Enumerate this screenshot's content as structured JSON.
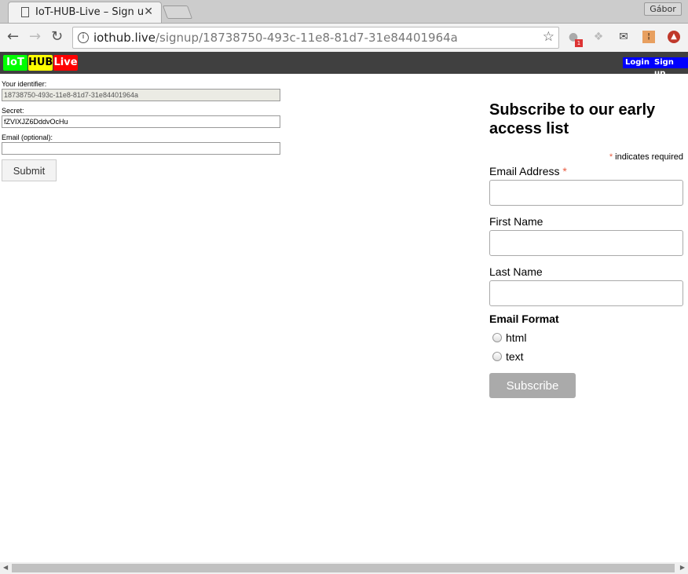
{
  "browser": {
    "tab_title": "IoT-HUB-Live – Sign u",
    "close": "✕",
    "user": "Gábor",
    "url_host": "iothub.live",
    "url_path": "/signup/18738750-493c-11e8-81d7-31e84401964a",
    "ext_badge": "1"
  },
  "site": {
    "logo": [
      "IoT",
      "HUB",
      "Live"
    ],
    "logo_colors": [
      "#00ff00",
      "#ffff00",
      "#ff0000"
    ],
    "login": "Login",
    "signup": "Sign up"
  },
  "signup": {
    "identifier_label": "Your identifier:",
    "identifier_value": "18738750-493c-11e8-81d7-31e84401964a",
    "secret_label": "Secret:",
    "secret_value": "fZVIXJZ6DddvOcHu",
    "email_label": "Email (optional):",
    "email_value": "",
    "submit": "Submit"
  },
  "subscribe": {
    "title": "Subscribe to our early access list",
    "required_mark": "*",
    "required_note": "indicates required",
    "email_label": "Email Address",
    "first_label": "First Name",
    "last_label": "Last Name",
    "format_label": "Email Format",
    "formats": [
      "html",
      "text"
    ],
    "button": "Subscribe"
  }
}
